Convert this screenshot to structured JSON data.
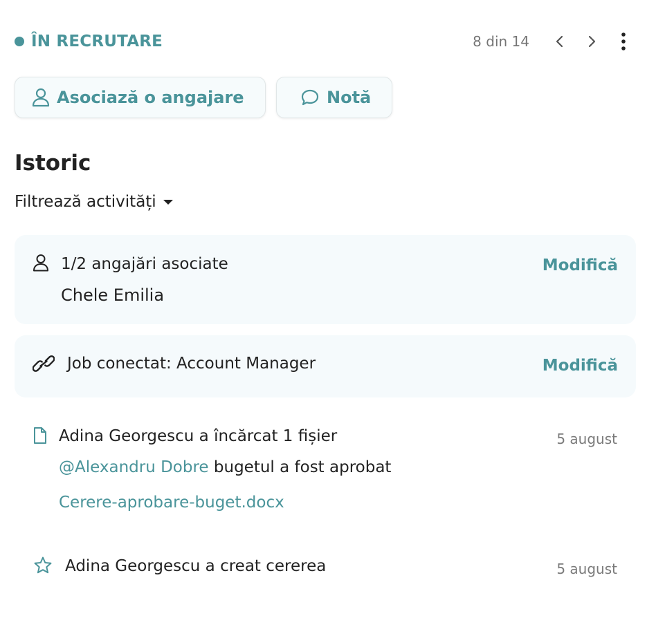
{
  "header": {
    "status_label": "ÎN RECRUTARE",
    "pager_text": "8 din 14",
    "prev_icon": "chevron-left-icon",
    "next_icon": "chevron-right-icon",
    "more_icon": "more-vertical-icon"
  },
  "actions": {
    "associate_label": "Asociază o angajare",
    "associate_icon": "person-icon",
    "note_label": "Notă",
    "note_icon": "comment-icon"
  },
  "history": {
    "title": "Istoric",
    "filter_label": "Filtrează activități"
  },
  "cards": {
    "associations": {
      "count_text": "1/2 angajări asociate",
      "name": "Chele Emilia",
      "modify_label": "Modifică"
    },
    "job": {
      "prefix": "Job conectat: ",
      "job_name": "Account Manager",
      "modify_label": "Modifică"
    }
  },
  "activities": [
    {
      "actor": "Adina Georgescu",
      "action": " a încărcat 1 ",
      "object": "fișier",
      "date": "5 august",
      "mention": "@Alexandru Dobre",
      "message": " bugetul a fost aprobat",
      "file": "Cerere-aprobare-buget.docx",
      "icon": "file-icon"
    },
    {
      "actor": "Adina Georgescu",
      "action": " a creat cererea",
      "date": "5 august",
      "icon": "star-icon"
    }
  ],
  "colors": {
    "accent": "#4a949a",
    "card_bg": "#f5fafc",
    "text": "#222222",
    "muted": "#7a7a7a"
  }
}
